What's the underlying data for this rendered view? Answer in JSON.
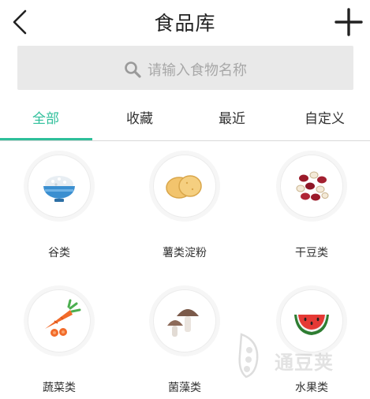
{
  "header": {
    "title": "食品库",
    "back_icon": "chevron-left-icon",
    "add_icon": "plus-icon"
  },
  "search": {
    "placeholder": "请输入食物名称",
    "icon": "search-icon"
  },
  "tabs": [
    {
      "label": "全部",
      "active": true
    },
    {
      "label": "收藏",
      "active": false
    },
    {
      "label": "最近",
      "active": false
    },
    {
      "label": "自定义",
      "active": false
    }
  ],
  "categories": [
    {
      "label": "谷类",
      "icon": "rice-bowl-icon"
    },
    {
      "label": "薯类淀粉",
      "icon": "potato-slices-icon"
    },
    {
      "label": "干豆类",
      "icon": "beans-icon"
    },
    {
      "label": "蔬菜类",
      "icon": "carrot-icon"
    },
    {
      "label": "菌藻类",
      "icon": "mushroom-icon"
    },
    {
      "label": "水果类",
      "icon": "watermelon-icon"
    }
  ],
  "watermark": {
    "text": "通豆荚"
  },
  "colors": {
    "accent": "#2ebf9a",
    "search_bg": "#e9e9e9"
  }
}
